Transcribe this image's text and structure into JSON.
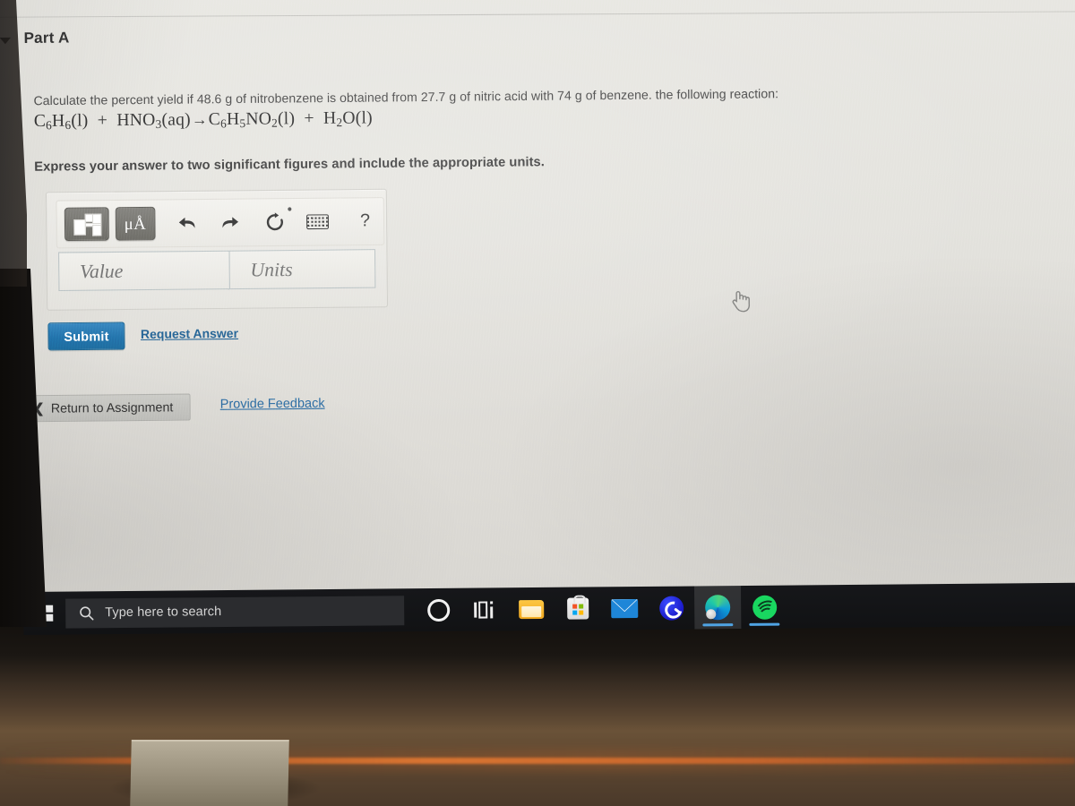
{
  "part": {
    "caret_icon": "caret-down-icon",
    "title": "Part A"
  },
  "question": {
    "text": "Calculate the percent yield if 48.6 g of nitrobenzene is obtained from 27.7 g of nitric acid with 74 g of benzene. the following reaction:",
    "equation_plain": "C6H6(l) + HNO3(aq)→C6H5NO2(l) + H2O(l)",
    "equation_parts": {
      "r1": "C",
      "r1s1": "6",
      "r1b": "H",
      "r1s2": "6",
      "r1state": "(l)",
      "plus1": "+",
      "r2": "HNO",
      "r2s": "3",
      "r2state": "(aq)",
      "arrow": "→",
      "p1": "C",
      "p1s1": "6",
      "p1b": "H",
      "p1s2": "5",
      "p1c": "NO",
      "p1s3": "2",
      "p1state": "(l)",
      "plus2": "+",
      "p2": "H",
      "p2s": "2",
      "p2b": "O",
      "p2state": "(l)"
    },
    "instruction": "Express your answer to two significant figures and include the appropriate units."
  },
  "answer_widget": {
    "toolbar": {
      "template_button": "template-icon",
      "units_button_label": "μÅ",
      "undo_label": "undo-icon",
      "redo_label": "redo-icon",
      "reset_label": "reset-icon",
      "keyboard_label": "keyboard-icon",
      "help_label": "?"
    },
    "value_placeholder": "Value",
    "units_placeholder": "Units",
    "value_current": "",
    "units_current": ""
  },
  "actions": {
    "submit_label": "Submit",
    "request_answer_label": "Request Answer",
    "return_label": "Return to Assignment",
    "return_chevron": "❮",
    "provide_feedback_label": "Provide Feedback"
  },
  "taskbar": {
    "start_label": "windows-start-icon",
    "search_placeholder": "Type here to search",
    "apps": [
      {
        "name": "cortana-circle-icon",
        "label": "Cortana"
      },
      {
        "name": "task-view-icon",
        "label": "Task View"
      },
      {
        "name": "file-explorer-icon",
        "label": "File Explorer"
      },
      {
        "name": "microsoft-store-icon",
        "label": "Microsoft Store"
      },
      {
        "name": "mail-icon",
        "label": "Mail"
      },
      {
        "name": "cortana-blue-icon",
        "label": "Cortana"
      },
      {
        "name": "microsoft-edge-icon",
        "label": "Microsoft Edge"
      },
      {
        "name": "spotify-icon",
        "label": "Spotify"
      }
    ]
  },
  "colors": {
    "submit_blue": "#1d72ab",
    "link_blue": "#2b6ea5",
    "page_background": "#e4e3de",
    "taskbar_background": "#16171a",
    "accent_underline": "#4fa3e3"
  },
  "cursor": {
    "type": "pointing-hand-cursor"
  }
}
